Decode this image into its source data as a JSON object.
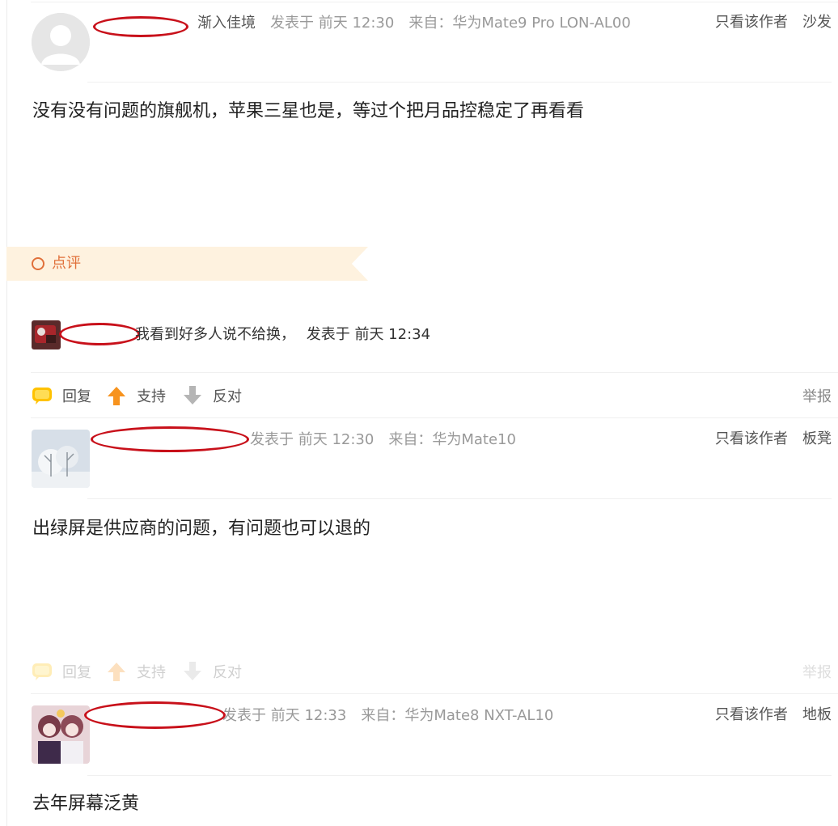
{
  "posts": [
    {
      "name_fragment": "渐入佳境",
      "posted": "发表于 前天 12:30",
      "source": "来自：华为Mate9 Pro LON-AL00",
      "view_author": "只看该作者",
      "floor": "沙发",
      "body": "没有没有问题的旗舰机，苹果三星也是，等过个把月品控稳定了再看看"
    },
    {
      "posted": "发表于 前天 12:30",
      "source": "来自：华为Mate10",
      "view_author": "只看该作者",
      "floor": "板凳",
      "body": "出绿屏是供应商的问题，有问题也可以退的"
    },
    {
      "posted": "发表于 前天 12:33",
      "source": "来自：华为Mate8 NXT-AL10",
      "view_author": "只看该作者",
      "floor": "地板",
      "body": "去年屏幕泛黄"
    }
  ],
  "comment_section": {
    "label": "点评",
    "reply_text": "我看到好多人说不给换，",
    "reply_time": "发表于 前天 12:34"
  },
  "actions": {
    "reply": "回复",
    "support": "支持",
    "oppose": "反对",
    "report": "举报"
  },
  "colors": {
    "redaction": "#c8101a",
    "banner_bg": "#fef2df",
    "accent": "#e0703a",
    "support_arrow": "#f7931e",
    "reply_bubble": "#ffc200"
  }
}
